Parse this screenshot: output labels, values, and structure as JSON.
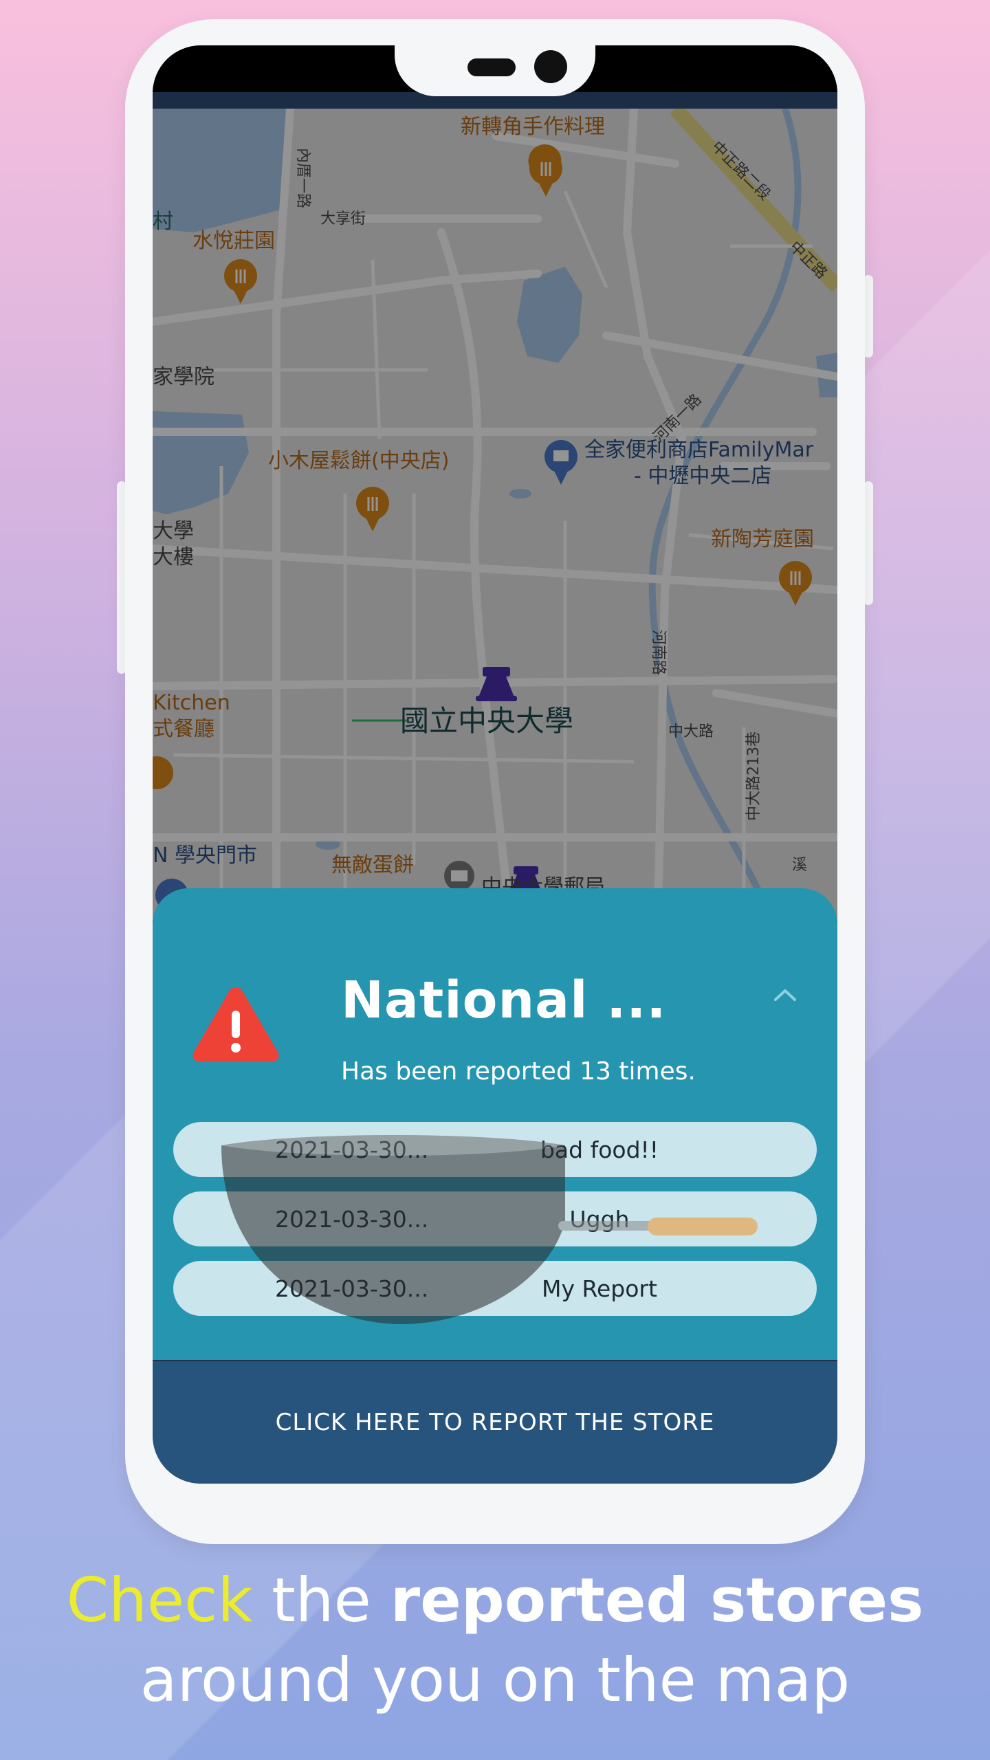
{
  "map": {
    "labels": {
      "restaurant_top": "新轉角手作料理",
      "road_zhongzheng_2": "中正路二段",
      "road_zhongzheng": "中正路",
      "neihu_road": "內厝一路",
      "dajing_street": "大享街",
      "village": "村",
      "shuiyue": "水悅莊園",
      "academy": "家學院",
      "xiaomuwu": "小木屋鬆餅(中央店)",
      "familymart": "全家便利商店FamilyMar",
      "familymart_branch": "- 中壢中央二店",
      "henan_1": "河南一路",
      "university_building_1": "大學",
      "university_building_2": "大樓",
      "xintao": "新陶芳庭園",
      "henan": "河南路",
      "zhongda_road": "中大路",
      "zhongda_lane": "中大路213巷",
      "kitchen": "Kitchen",
      "restaurant_left": "式餐廳",
      "ncu": "國立中央大學",
      "xueyang_market": "N 學央門市",
      "wudi": "無敵蛋餅",
      "post_office": "中央大學郵局",
      "river": "溪"
    }
  },
  "sheet": {
    "store_title": "National ...",
    "report_count_text": "Has been reported 13 times.",
    "reports": [
      {
        "date": "2021-03-30...",
        "text": "bad food!!"
      },
      {
        "date": "2021-03-30...",
        "text": "Uggh"
      },
      {
        "date": "2021-03-30...",
        "text": "My Report"
      }
    ],
    "report_button_label": "CLICK HERE TO REPORT THE STORE",
    "colors": {
      "sheet": "#2595b0",
      "button": "#27547c",
      "warning": "#ef4237"
    }
  },
  "caption": {
    "word_check": "Check",
    "word_the": " the ",
    "word_reported_stores": "reported stores",
    "line2": "around you on the map"
  },
  "icons": {
    "warning": "warning-triangle-icon",
    "collapse": "chevron-up-icon",
    "restaurant": "restaurant-pin-icon",
    "shop": "shop-pin-icon",
    "reported_store": "push-pin-icon",
    "mail": "mail-icon"
  }
}
